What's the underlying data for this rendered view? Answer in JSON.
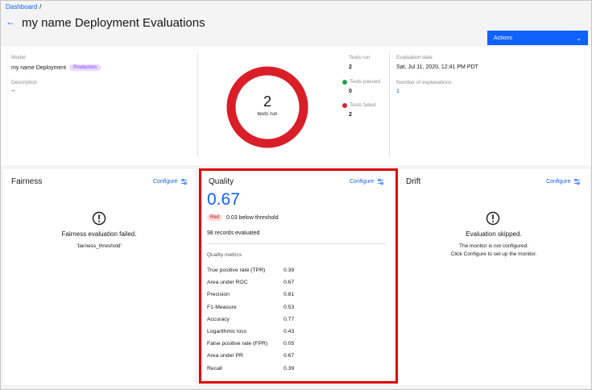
{
  "breadcrumb": {
    "root": "Dashboard",
    "sep": "/"
  },
  "header": {
    "back_icon": "arrow-left-icon",
    "title": "my name Deployment Evaluations",
    "actions_label": "Actions"
  },
  "summary": {
    "model_label": "Model",
    "model_value": "my name Deployment",
    "model_tag": "Production",
    "description_label": "Description",
    "description_value": "--",
    "donut": {
      "count": "2",
      "caption": "tests run",
      "passed": 0,
      "failed": 2,
      "color_failed": "#da1e28"
    },
    "tests_run_label": "Tests run",
    "tests_run_value": "2",
    "tests_passed_label": "Tests passed",
    "tests_passed_value": "0",
    "tests_failed_label": "Tests failed",
    "tests_failed_value": "2",
    "eval_date_label": "Evaluation date",
    "eval_date_value": "Sat, Jul 11, 2020, 12:41 PM PDT",
    "explanations_label": "Number of explanations",
    "explanations_value": "1"
  },
  "fairness": {
    "title": "Fairness",
    "configure": "Configure",
    "message": "Fairness evaluation failed.",
    "sub": "'fairness_threshold'"
  },
  "quality": {
    "title": "Quality",
    "configure": "Configure",
    "score": "0.67",
    "status_tag": "Red",
    "threshold_text": "0.03 below threshold",
    "records": "98 records evaluated",
    "metrics_label": "Quality metrics",
    "metrics": [
      {
        "name": "True positive rate (TPR)",
        "value": "0.39"
      },
      {
        "name": "Area under ROC",
        "value": "0.67"
      },
      {
        "name": "Precision",
        "value": "0.81"
      },
      {
        "name": "F1-Measure",
        "value": "0.53"
      },
      {
        "name": "Accuracy",
        "value": "0.77"
      },
      {
        "name": "Logarithmic loss",
        "value": "0.43"
      },
      {
        "name": "False positive rate (FPR)",
        "value": "0.05"
      },
      {
        "name": "Area under PR",
        "value": "0.67"
      },
      {
        "name": "Recall",
        "value": "0.39"
      }
    ]
  },
  "drift": {
    "title": "Drift",
    "configure": "Configure",
    "message": "Evaluation skipped.",
    "sub1": "The monitor is not configured.",
    "sub2": "Click Configure to set up the monitor."
  },
  "colors": {
    "accent": "#0f62fe",
    "danger": "#da1e28",
    "success": "#24a148",
    "highlight": "#e00000"
  }
}
